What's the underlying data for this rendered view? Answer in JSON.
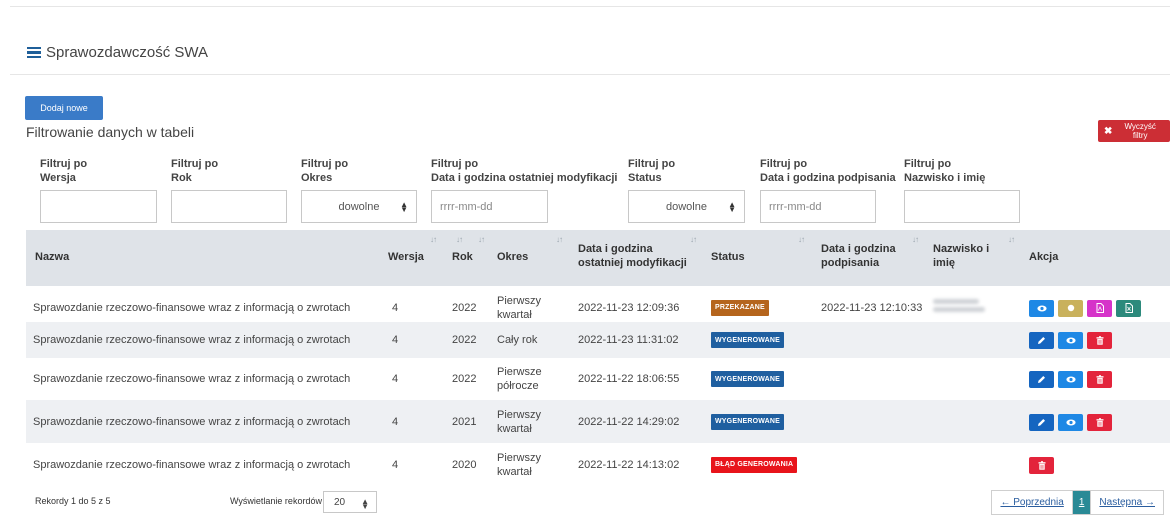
{
  "panel": {
    "title": "Sprawozdawczość SWA"
  },
  "buttons": {
    "add": "Dodaj nowe",
    "clear_filters": "Wyczyść filtry"
  },
  "filter_heading": "Filtrowanie danych w tabeli",
  "filters": [
    {
      "l1": "Filtruj po",
      "l2": "Wersja",
      "kind": "text",
      "value": ""
    },
    {
      "l1": "Filtruj po",
      "l2": "Rok",
      "kind": "text",
      "value": ""
    },
    {
      "l1": "Filtruj po",
      "l2": "Okres",
      "kind": "select",
      "value": "dowolne"
    },
    {
      "l1": "Filtruj po",
      "l2": "Data i godzina ostatniej modyfikacji",
      "kind": "date",
      "placeholder": "rrrr-mm-dd"
    },
    {
      "l1": "Filtruj po",
      "l2": "Status",
      "kind": "select",
      "value": "dowolne"
    },
    {
      "l1": "Filtruj po",
      "l2": "Data i godzina podpisania",
      "kind": "date",
      "placeholder": "rrrr-mm-dd"
    },
    {
      "l1": "Filtruj po",
      "l2": "Nazwisko i imię",
      "kind": "text",
      "value": ""
    }
  ],
  "columns": {
    "nazwa": "Nazwa",
    "wersja": "Wersja",
    "rok": "Rok",
    "okres": "Okres",
    "mod_1": "Data i godzina",
    "mod_2": "ostatniej modyfikacji",
    "status": "Status",
    "sign_1": "Data i godzina",
    "sign_2": "podpisania",
    "name_1": "Nazwisko i",
    "name_2": "imię",
    "akcja": "Akcja"
  },
  "rows": [
    {
      "nazwa": "Sprawozdanie rzeczowo-finansowe wraz z informacją o zwrotach",
      "wersja": "4",
      "rok": "2022",
      "okres_1": "Pierwszy",
      "okres_2": "kwartał",
      "modified": "2022-11-23 12:09:36",
      "status": "PRZEKAZANE",
      "status_color": "#b5651d",
      "signed": "2022-11-23 12:10:33",
      "redacted": true,
      "actions": [
        "view",
        "circle",
        "pdf",
        "excel"
      ]
    },
    {
      "nazwa": "Sprawozdanie rzeczowo-finansowe wraz z informacją o zwrotach",
      "wersja": "4",
      "rok": "2022",
      "okres_1": "Cały rok",
      "okres_2": "",
      "modified": "2022-11-23 11:31:02",
      "status": "WYGENEROWANE",
      "status_color": "#1f5fa0",
      "signed": "",
      "redacted": false,
      "actions": [
        "edit",
        "view",
        "delete"
      ]
    },
    {
      "nazwa": "Sprawozdanie rzeczowo-finansowe wraz z informacją o zwrotach",
      "wersja": "4",
      "rok": "2022",
      "okres_1": "Pierwsze",
      "okres_2": "półrocze",
      "modified": "2022-11-22 18:06:55",
      "status": "WYGENEROWANE",
      "status_color": "#1f5fa0",
      "signed": "",
      "redacted": false,
      "actions": [
        "edit",
        "view",
        "delete"
      ]
    },
    {
      "nazwa": "Sprawozdanie rzeczowo-finansowe wraz z informacją o zwrotach",
      "wersja": "4",
      "rok": "2021",
      "okres_1": "Pierwszy",
      "okres_2": "kwartał",
      "modified": "2022-11-22 14:29:02",
      "status": "WYGENEROWANE",
      "status_color": "#1f5fa0",
      "signed": "",
      "redacted": false,
      "actions": [
        "edit",
        "view",
        "delete"
      ]
    },
    {
      "nazwa": "Sprawozdanie rzeczowo-finansowe wraz z informacją o zwrotach",
      "wersja": "4",
      "rok": "2020",
      "okres_1": "Pierwszy",
      "okres_2": "kwartał",
      "modified": "2022-11-22 14:13:02",
      "status": "BŁĄD GENEROWANIA",
      "status_color": "#e8141b",
      "signed": "",
      "redacted": false,
      "actions": [
        "delete"
      ]
    }
  ],
  "action_styles": {
    "view": {
      "color": "#1e88e5",
      "icon": "eye-icon"
    },
    "circle": {
      "color": "#c9b15c",
      "icon": "circle-icon"
    },
    "pdf": {
      "color": "#d633c9",
      "icon": "pdf-icon"
    },
    "excel": {
      "color": "#2c8a7c",
      "icon": "excel-icon"
    },
    "edit": {
      "color": "#1565c0",
      "icon": "pencil-icon"
    },
    "delete": {
      "color": "#e3243b",
      "icon": "trash-icon"
    }
  },
  "footer": {
    "records": "Rekordy 1 do 5 z 5",
    "show_label": "Wyświetlanie rekordów",
    "page_size": "20",
    "prev": "← Poprzednia",
    "current_page": "1",
    "next": "Następna →"
  }
}
